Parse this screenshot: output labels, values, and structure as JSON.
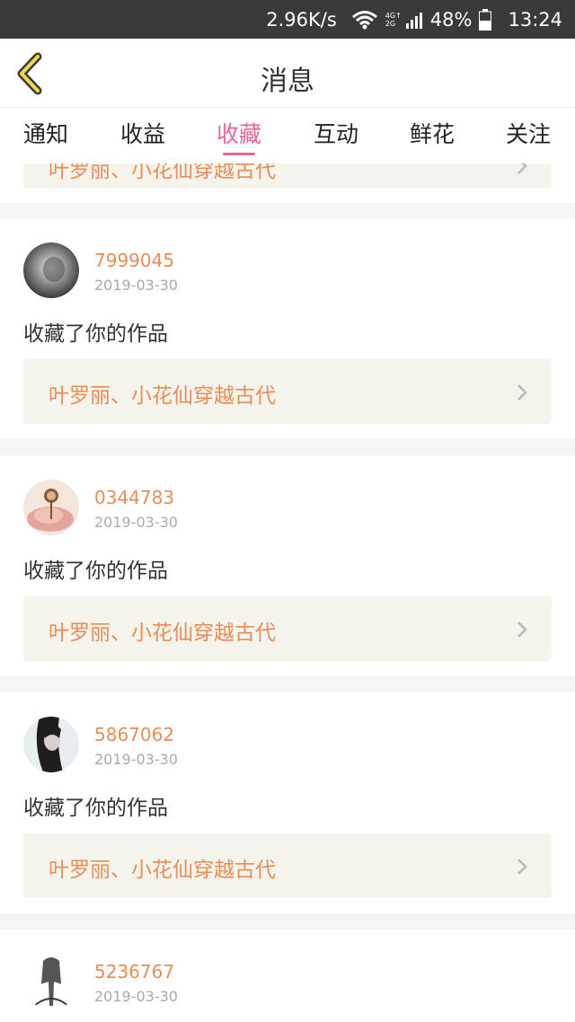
{
  "status_bar": {
    "net_speed": "2.96K/s",
    "network_top": "4G↑",
    "network_bottom": "2G",
    "battery": "48%",
    "time": "13:24"
  },
  "header": {
    "title": "消息"
  },
  "tabs": [
    {
      "label": "通知"
    },
    {
      "label": "收益"
    },
    {
      "label": "收藏",
      "active": true
    },
    {
      "label": "互动"
    },
    {
      "label": "鲜花"
    },
    {
      "label": "关注"
    }
  ],
  "colors": {
    "accent_pink": "#e8659a",
    "accent_orange": "#e88d55",
    "card_inner_bg": "#f4f3ec"
  },
  "feed": {
    "partial_top_title": "叶罗丽、小花仙穿越古代",
    "items": [
      {
        "user": "7999045",
        "date": "2019-03-30",
        "action": "收藏了你的作品",
        "work_title": "叶罗丽、小花仙穿越古代"
      },
      {
        "user": "0344783",
        "date": "2019-03-30",
        "action": "收藏了你的作品",
        "work_title": "叶罗丽、小花仙穿越古代"
      },
      {
        "user": "5867062",
        "date": "2019-03-30",
        "action": "收藏了你的作品",
        "work_title": "叶罗丽、小花仙穿越古代"
      },
      {
        "user": "5236767",
        "date": "2019-03-30"
      }
    ]
  }
}
